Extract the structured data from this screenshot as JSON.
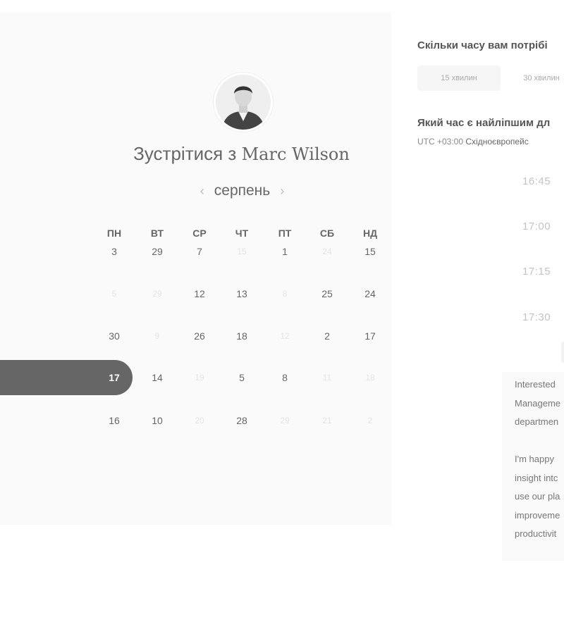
{
  "booking": {
    "title_prefix": "Зустрітися з",
    "host_name": "Marc Wilson",
    "avatar_icon": "profile-photo-icon"
  },
  "calendar": {
    "month": "серпень",
    "prev_icon": "chevron-left-icon",
    "next_icon": "chevron-right-icon",
    "weekdays": [
      "ПН",
      "ВТ",
      "СР",
      "ЧТ",
      "ПТ",
      "СБ",
      "НД"
    ],
    "weeks": [
      [
        {
          "d": "3"
        },
        {
          "d": "29"
        },
        {
          "d": "7"
        },
        {
          "d": "15",
          "dim": true
        },
        {
          "d": "1"
        },
        {
          "d": "24",
          "dim": true
        },
        {
          "d": "15"
        }
      ],
      [
        {
          "d": "5",
          "dim": true
        },
        {
          "d": "29",
          "dim": true
        },
        {
          "d": "12"
        },
        {
          "d": "13"
        },
        {
          "d": "8",
          "dim": true
        },
        {
          "d": "25"
        },
        {
          "d": "24"
        }
      ],
      [
        {
          "d": "30"
        },
        {
          "d": "9",
          "dim": true
        },
        {
          "d": "26"
        },
        {
          "d": "18"
        },
        {
          "d": "12",
          "dim": true
        },
        {
          "d": "2"
        },
        {
          "d": "17"
        }
      ],
      [
        {
          "d": "17",
          "selected": true
        },
        {
          "d": "14"
        },
        {
          "d": "19",
          "dim": true
        },
        {
          "d": "5"
        },
        {
          "d": "8"
        },
        {
          "d": "11",
          "dim": true
        },
        {
          "d": "18",
          "dim": true
        }
      ],
      [
        {
          "d": "16"
        },
        {
          "d": "10"
        },
        {
          "d": "20",
          "dim": true
        },
        {
          "d": "28"
        },
        {
          "d": "29",
          "dim": true
        },
        {
          "d": "21",
          "dim": true
        },
        {
          "d": "2",
          "dim": true
        }
      ]
    ],
    "selected_color": "#666666"
  },
  "duration": {
    "question": "Скільки часу вам потрібі",
    "options": [
      "15 хвилин",
      "30 хвилин"
    ],
    "active_index": 0
  },
  "time": {
    "question": "Який час є найліпшим дл",
    "timezone_offset": "UTC +03:00",
    "timezone_name": "Східноєвропейс",
    "slots": [
      "16:45",
      "17:00",
      "17:15",
      "17:30"
    ]
  },
  "bio": {
    "paragraph1": "Interested\nManageme\ndepartmen",
    "paragraph2": "I'm happy\ninsight intc\nuse our pla\nimproveme\nproductivit"
  }
}
